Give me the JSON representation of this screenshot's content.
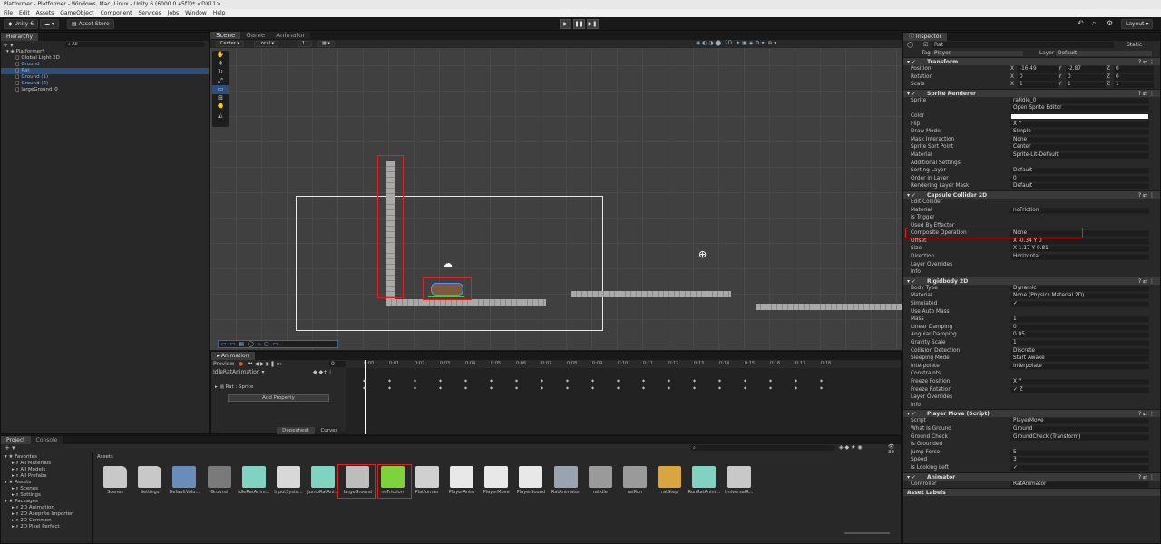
{
  "window": {
    "title": "Platformer - Platformer - Windows, Mac, Linux - Unity 6 (6000.0.45f1)* <DX11>"
  },
  "menu": [
    "File",
    "Edit",
    "Assets",
    "GameObject",
    "Component",
    "Services",
    "Jobs",
    "Window",
    "Help"
  ],
  "toolbar": {
    "account": "Unity 6",
    "asset_store": "Asset Store",
    "layout": "Layout"
  },
  "hierarchy": {
    "tab": "Hierarchy",
    "search": "All",
    "items": [
      {
        "label": "Platformer*"
      },
      {
        "label": "Global Light 2D"
      },
      {
        "label": "Ground"
      },
      {
        "label": "Rat"
      },
      {
        "label": "Ground (1)"
      },
      {
        "label": "Ground (2)"
      },
      {
        "label": "largeGround_0"
      }
    ]
  },
  "scene": {
    "tabs": [
      "Scene",
      "Game",
      "Animator"
    ],
    "pivot": "Center",
    "space": "Local",
    "grid_snap": "1"
  },
  "animation": {
    "tab": "Animation",
    "preview": "Preview",
    "clip": "IdleRatAnimation",
    "frame": "0",
    "property": "Rat : Sprite",
    "add_property": "Add Property",
    "dopesheet": "Dopesheet",
    "curves": "Curves",
    "times": [
      "0:00",
      "0:01",
      "0:02",
      "0:03",
      "0:04",
      "0:05",
      "0:06",
      "0:07",
      "0:08",
      "0:09",
      "0:10",
      "0:11",
      "0:12",
      "0:13",
      "0:14",
      "0:15",
      "0:16",
      "0:17",
      "0:18"
    ]
  },
  "project": {
    "tabs": [
      "Project",
      "Console"
    ],
    "tree": [
      {
        "label": "Favorites"
      },
      {
        "label": "All Materials"
      },
      {
        "label": "All Models"
      },
      {
        "label": "All Prefabs"
      },
      {
        "label": "Assets"
      },
      {
        "label": "Scenes"
      },
      {
        "label": "Settings"
      },
      {
        "label": "Packages"
      },
      {
        "label": "2D Animation"
      },
      {
        "label": "2D Aseprite Importer"
      },
      {
        "label": "2D Common"
      },
      {
        "label": "2D Pixel Perfect"
      }
    ],
    "breadcrumb": "Assets",
    "count": "30",
    "assets": [
      {
        "label": "Scenes",
        "color": "#c8c8c8"
      },
      {
        "label": "Settings",
        "color": "#c8c8c8"
      },
      {
        "label": "DefaultVolu...",
        "color": "#6a8cb8"
      },
      {
        "label": "Ground",
        "color": "#7a7a7a"
      },
      {
        "label": "IdleRatAnim...",
        "color": "#7fd3c0"
      },
      {
        "label": "InputSyste...",
        "color": "#d8d8d8"
      },
      {
        "label": "JumpRatAni...",
        "color": "#7fd3c0"
      },
      {
        "label": "largeGround",
        "color": "#bdbdbd"
      },
      {
        "label": "noFriction",
        "color": "#7ed33a"
      },
      {
        "label": "Platformer",
        "color": "#d0d0d0"
      },
      {
        "label": "PlayerAnim",
        "color": "#e8e8e8"
      },
      {
        "label": "PlayerMove",
        "color": "#e8e8e8"
      },
      {
        "label": "PlayerSound",
        "color": "#e8e8e8"
      },
      {
        "label": "RatAnimator",
        "color": "#9aa4b0"
      },
      {
        "label": "ratIdle",
        "color": "#9a9a9a"
      },
      {
        "label": "ratRun",
        "color": "#9a9a9a"
      },
      {
        "label": "ratStep",
        "color": "#d8a640"
      },
      {
        "label": "RunRatAnim...",
        "color": "#7fd3c0"
      },
      {
        "label": "UniversalR...",
        "color": "#c8c8c8"
      }
    ]
  },
  "inspector": {
    "tab": "Inspector",
    "name": "Rat",
    "static": "Static",
    "tag_label": "Tag",
    "tag": "Player",
    "layer_label": "Layer",
    "layer": "Default",
    "transform": {
      "title": "Transform",
      "position": {
        "label": "Position",
        "x": "-16.49",
        "y": "-2.87",
        "z": "0"
      },
      "rotation": {
        "label": "Rotation",
        "x": "0",
        "y": "0",
        "z": "0"
      },
      "scale": {
        "label": "Scale",
        "x": "1",
        "y": "1",
        "z": "1"
      }
    },
    "sprite_renderer": {
      "title": "Sprite Renderer",
      "rows": [
        {
          "label": "Sprite",
          "value": "ratIdle_0"
        },
        {
          "label": "",
          "value": "Open Sprite Editor"
        },
        {
          "label": "Color",
          "value": ""
        },
        {
          "label": "Flip",
          "value": "X   Y"
        },
        {
          "label": "Draw Mode",
          "value": "Simple"
        },
        {
          "label": "Mask Interaction",
          "value": "None"
        },
        {
          "label": "Sprite Sort Point",
          "value": "Center"
        },
        {
          "label": "Material",
          "value": "Sprite-Lit-Default"
        },
        {
          "label": "Additional Settings",
          "value": ""
        },
        {
          "label": "Sorting Layer",
          "value": "Default"
        },
        {
          "label": "Order in Layer",
          "value": "0"
        },
        {
          "label": "Rendering Layer Mask",
          "value": "Default"
        }
      ]
    },
    "capsule": {
      "title": "Capsule Collider 2D",
      "rows": [
        {
          "label": "Edit Collider",
          "value": ""
        },
        {
          "label": "Material",
          "value": "noFriction"
        },
        {
          "label": "Is Trigger",
          "value": ""
        },
        {
          "label": "Used By Effector",
          "value": ""
        },
        {
          "label": "Composite Operation",
          "value": "None"
        },
        {
          "label": "Offset",
          "value": "X -0.34   Y 0"
        },
        {
          "label": "Size",
          "value": "X 1.17   Y 0.81"
        },
        {
          "label": "Direction",
          "value": "Horizontal"
        },
        {
          "label": "Layer Overrides",
          "value": ""
        },
        {
          "label": "Info",
          "value": ""
        }
      ]
    },
    "rigidbody": {
      "title": "Rigidbody 2D",
      "rows": [
        {
          "label": "Body Type",
          "value": "Dynamic"
        },
        {
          "label": "Material",
          "value": "None (Physics Material 2D)"
        },
        {
          "label": "Simulated",
          "value": "✓"
        },
        {
          "label": "Use Auto Mass",
          "value": ""
        },
        {
          "label": "Mass",
          "value": "1"
        },
        {
          "label": "Linear Damping",
          "value": "0"
        },
        {
          "label": "Angular Damping",
          "value": "0.05"
        },
        {
          "label": "Gravity Scale",
          "value": "1"
        },
        {
          "label": "Collision Detection",
          "value": "Discrete"
        },
        {
          "label": "Sleeping Mode",
          "value": "Start Awake"
        },
        {
          "label": "Interpolate",
          "value": "Interpolate"
        },
        {
          "label": "Constraints",
          "value": ""
        },
        {
          "label": "Freeze Position",
          "value": "X   Y"
        },
        {
          "label": "Freeze Rotation",
          "value": "✓ Z"
        },
        {
          "label": "Layer Overrides",
          "value": ""
        },
        {
          "label": "Info",
          "value": ""
        }
      ]
    },
    "player_move": {
      "title": "Player Move (Script)",
      "rows": [
        {
          "label": "Script",
          "value": "PlayerMove"
        },
        {
          "label": "What Is Ground",
          "value": "Ground"
        },
        {
          "label": "Ground Check",
          "value": "GroundCheck (Transform)"
        },
        {
          "label": "Is Grounded",
          "value": ""
        },
        {
          "label": "Jump Force",
          "value": "5"
        },
        {
          "label": "Speed",
          "value": "3"
        },
        {
          "label": "Is Looking Left",
          "value": "✓"
        }
      ]
    },
    "animator": {
      "title": "Animator",
      "rows": [
        {
          "label": "Controller",
          "value": "RatAnimator"
        }
      ]
    },
    "asset_labels": "Asset Labels"
  }
}
